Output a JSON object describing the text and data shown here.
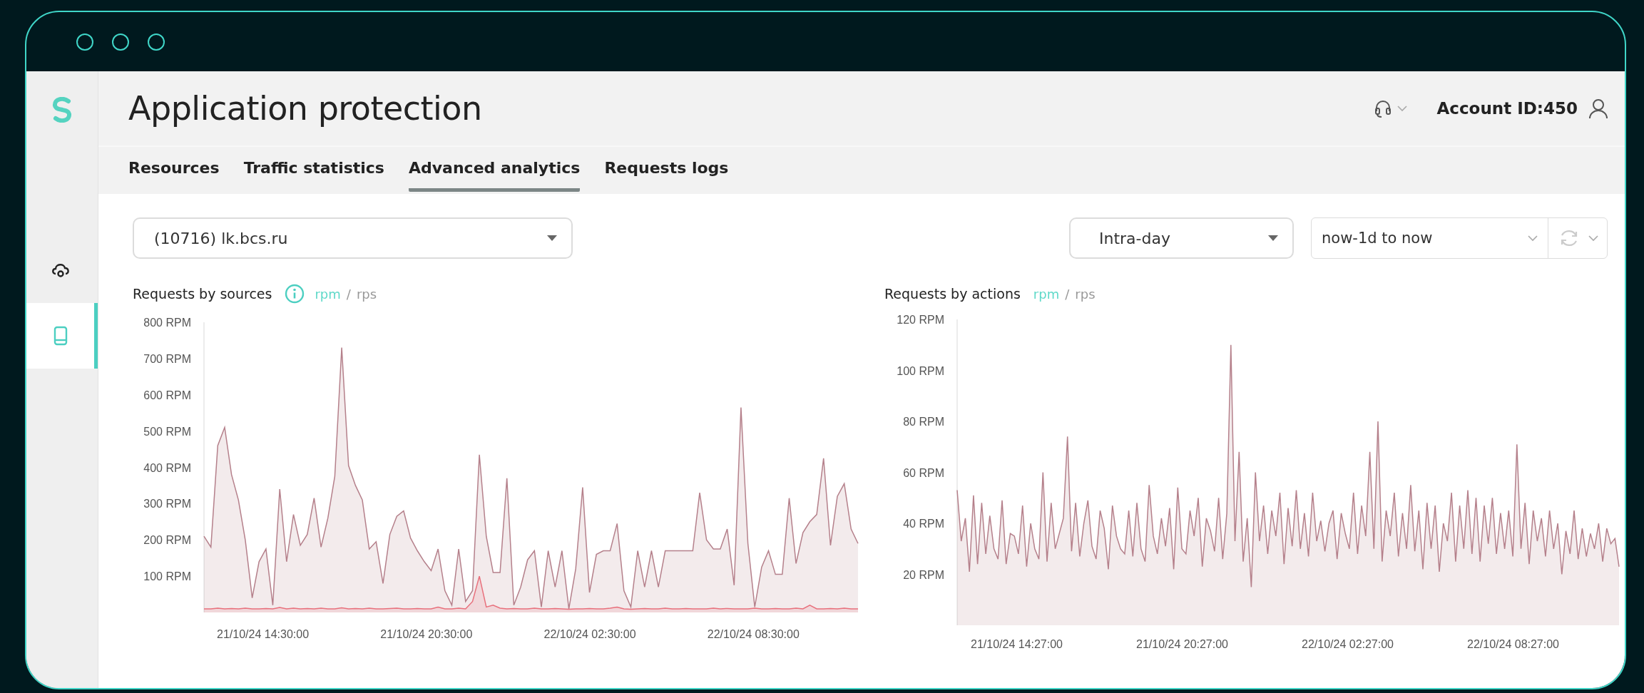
{
  "sidebar": {
    "items": [
      {
        "kind": "cloud",
        "selected": false
      },
      {
        "kind": "tablet",
        "selected": true
      }
    ]
  },
  "header": {
    "title": "Application protection",
    "account": "Account ID:450"
  },
  "tabs": [
    {
      "label": "Resources",
      "selected": false
    },
    {
      "label": "Traffic statistics",
      "selected": false
    },
    {
      "label": "Advanced analytics",
      "selected": true
    },
    {
      "label": "Requests logs",
      "selected": false
    }
  ],
  "filters": {
    "resource": "(10716) lk.bcs.ru",
    "interval": "Intra-day",
    "time_range": "now-1d to now"
  },
  "charts": [
    {
      "title": "Requests by sources",
      "info": true,
      "separator": "/",
      "units": [
        {
          "label": "rpm",
          "selected": true
        },
        {
          "label": "rps",
          "selected": false
        }
      ],
      "x_labels": [
        "21/10/24 14:30:00",
        "21/10/24 20:30:00",
        "22/10/24 02:30:00",
        "22/10/24 08:30:00"
      ],
      "chart_data": {
        "type": "area",
        "ylim": [
          0,
          800
        ],
        "yticks": [
          {
            "value": 100,
            "label": "100 RPM"
          },
          {
            "value": 200,
            "label": "200 RPM"
          },
          {
            "value": 300,
            "label": "300 RPM"
          },
          {
            "value": 400,
            "label": "400 RPM"
          },
          {
            "value": 500,
            "label": "500 RPM"
          },
          {
            "value": 600,
            "label": "600 RPM"
          },
          {
            "value": 700,
            "label": "700 RPM"
          },
          {
            "value": 800,
            "label": "800 RPM"
          }
        ],
        "series": [
          {
            "color": "#b5808b",
            "values": [
              210,
              180,
              460,
              510,
              380,
              310,
              200,
              40,
              140,
              175,
              20,
              340,
              140,
              270,
              185,
              215,
              315,
              180,
              260,
              375,
              730,
              405,
              350,
              310,
              175,
              195,
              80,
              215,
              265,
              280,
              205,
              170,
              140,
              115,
              175,
              60,
              20,
              175,
              30,
              60,
              435,
              210,
              110,
              110,
              370,
              20,
              70,
              145,
              170,
              15,
              170,
              70,
              170,
              10,
              120,
              345,
              55,
              160,
              170,
              170,
              245,
              60,
              15,
              170,
              70,
              170,
              70,
              170,
              170,
              170,
              170,
              170,
              330,
              200,
              175,
              175,
              230,
              75,
              565,
              190,
              15,
              125,
              170,
              105,
              105,
              315,
              135,
              220,
              250,
              270,
              425,
              185,
              320,
              355,
              230,
              190
            ]
          },
          {
            "color": "#e8707c",
            "values": [
              10,
              10,
              12,
              10,
              11,
              10,
              12,
              10,
              10,
              11,
              10,
              14,
              10,
              12,
              10,
              11,
              10,
              12,
              10,
              10,
              13,
              10,
              11,
              10,
              12,
              10,
              10,
              11,
              12,
              10,
              10,
              11,
              10,
              10,
              15,
              10,
              10,
              12,
              10,
              30,
              100,
              15,
              20,
              12,
              10,
              11,
              10,
              10,
              12,
              10,
              10,
              11,
              10,
              9,
              10,
              10,
              11,
              10,
              10,
              12,
              15,
              10,
              9,
              10,
              11,
              10,
              10,
              12,
              10,
              10,
              11,
              10,
              10,
              10,
              12,
              10,
              11,
              10,
              10,
              10,
              12,
              10,
              10,
              11,
              10,
              10,
              12,
              10,
              20,
              10,
              10,
              11,
              10,
              12,
              10,
              10
            ]
          }
        ]
      }
    },
    {
      "title": "Requests by actions",
      "separator": "/",
      "units": [
        {
          "label": "rpm",
          "selected": true
        },
        {
          "label": "rps",
          "selected": false
        }
      ],
      "x_labels": [
        "21/10/24 14:27:00",
        "21/10/24 20:27:00",
        "22/10/24 02:27:00",
        "22/10/24 08:27:00"
      ],
      "chart_data": {
        "type": "area",
        "ylim": [
          0,
          120
        ],
        "yticks": [
          {
            "value": 20,
            "label": "20 RPM"
          },
          {
            "value": 40,
            "label": "40 RPM"
          },
          {
            "value": 60,
            "label": "60 RPM"
          },
          {
            "value": 80,
            "label": "80 RPM"
          },
          {
            "value": 100,
            "label": "100 RPM"
          },
          {
            "value": 120,
            "label": "120 RPM"
          }
        ],
        "series": [
          {
            "color": "#b5808b",
            "values": [
              53,
              33,
              42,
              21,
              51,
              24,
              48,
              28,
              43,
              30,
              26,
              49,
              24,
              36,
              35,
              28,
              47,
              23,
              40,
              30,
              26,
              60,
              25,
              48,
              30,
              36,
              42,
              74,
              29,
              48,
              27,
              40,
              49,
              31,
              26,
              45,
              38,
              22,
              47,
              35,
              30,
              28,
              45,
              27,
              48,
              30,
              25,
              55,
              35,
              28,
              42,
              31,
              46,
              22,
              54,
              30,
              28,
              45,
              35,
              50,
              23,
              42,
              37,
              29,
              50,
              26,
              44,
              110,
              33,
              68,
              25,
              42,
              15,
              60,
              33,
              47,
              28,
              45,
              35,
              52,
              24,
              46,
              31,
              53,
              30,
              44,
              27,
              52,
              33,
              41,
              29,
              40,
              45,
              26,
              44,
              36,
              30,
              52,
              28,
              47,
              35,
              68,
              30,
              80,
              25,
              45,
              35,
              52,
              27,
              44,
              30,
              55,
              29,
              45,
              22,
              48,
              30,
              47,
              21,
              40,
              33,
              52,
              25,
              47,
              30,
              53,
              28,
              50,
              25,
              47,
              32,
              50,
              28,
              44,
              30,
              45,
              27,
              71,
              30,
              48,
              24,
              45,
              33,
              42,
              27,
              45,
              30,
              40,
              20,
              37,
              28,
              45,
              26,
              38,
              27,
              36,
              30,
              40,
              25,
              38,
              32,
              34,
              23
            ]
          }
        ]
      }
    }
  ]
}
